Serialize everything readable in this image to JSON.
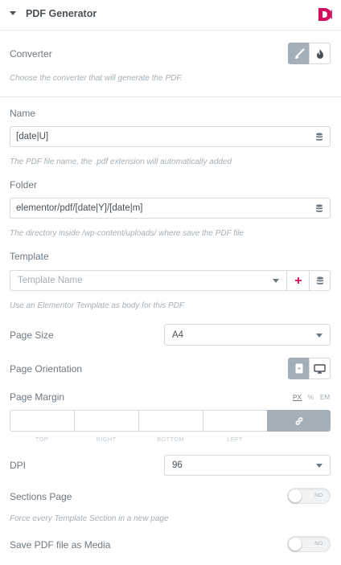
{
  "header": {
    "title": "PDF Generator",
    "logo_color": "#d30c5c"
  },
  "converter": {
    "label": "Converter",
    "help": "Choose the converter that will generate the PDF.",
    "options": [
      "brush-icon",
      "fire-icon"
    ],
    "selected": 0
  },
  "name": {
    "label": "Name",
    "value": "[date|U]",
    "help": "The PDF file name, the .pdf extension will automatically added"
  },
  "folder": {
    "label": "Folder",
    "value": "elementor/pdf/[date|Y]/[date|m]",
    "help": "The directory inside /wp-content/uploads/ where save the PDF file"
  },
  "template": {
    "label": "Template",
    "placeholder": "Template Name",
    "help": "Use an Elementor Template as body for this PDF"
  },
  "page_size": {
    "label": "Page Size",
    "value": "A4"
  },
  "page_orientation": {
    "label": "Page Orientation",
    "options": [
      "portrait-icon",
      "landscape-icon"
    ],
    "selected": 0
  },
  "page_margin": {
    "label": "Page Margin",
    "units": [
      "PX",
      "%",
      "EM"
    ],
    "selected_unit": "PX",
    "sides": [
      "TOP",
      "RIGHT",
      "BOTTOM",
      "LEFT"
    ]
  },
  "dpi": {
    "label": "DPI",
    "value": "96"
  },
  "sections_page": {
    "label": "Sections Page",
    "state": "NO",
    "help": "Force every Template Section in a new page"
  },
  "save_media": {
    "label": "Save PDF file as Media",
    "state": "NO"
  },
  "colors": {
    "accent": "#a4afb7",
    "text": "#6d7882",
    "heading": "#495157",
    "add": "#d30c5c"
  }
}
